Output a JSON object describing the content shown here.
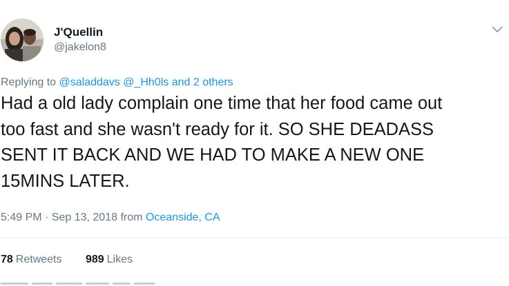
{
  "tweet": {
    "display_name": "J'Quellin",
    "handle": "@jakelon8",
    "reply_prefix": "Replying to",
    "reply_mentions": "@saladdavs @_Hh0ls and 2 others",
    "text_lines": [
      "Had a old lady complain one time that her food came out",
      "too fast and she wasn't ready for it. SO SHE DEADASS",
      "SENT IT BACK AND WE HAD TO MAKE A NEW ONE",
      "15MINS LATER."
    ],
    "timestamp": "5:49 PM · Sep 13, 2018 from",
    "location": "Oceanside, CA",
    "retweets": {
      "count": "78",
      "label": "Retweets"
    },
    "likes": {
      "count": "989",
      "label": "Likes"
    }
  },
  "icons": {
    "menu": "chevron-down-icon"
  },
  "colors": {
    "link": "#1b95e0",
    "secondary_text": "#657786",
    "primary_text": "#14171a"
  }
}
